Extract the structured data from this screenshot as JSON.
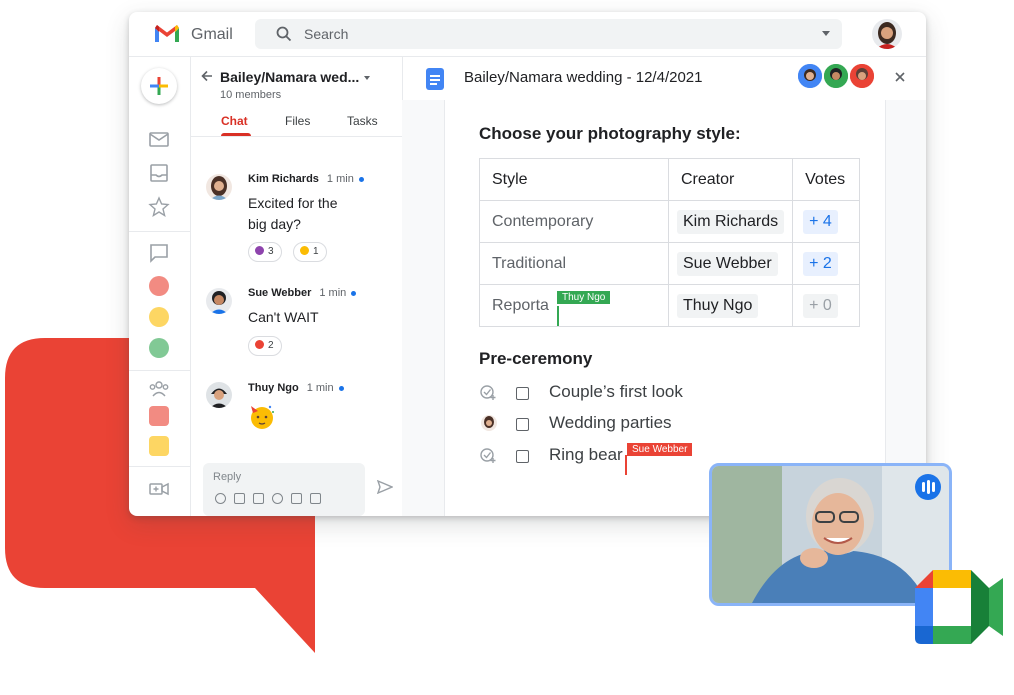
{
  "app": {
    "name": "Gmail",
    "search_placeholder": "Search"
  },
  "chat": {
    "room_title": "Bailey/Namara wed...",
    "members": "10 members",
    "tabs": [
      "Chat",
      "Files",
      "Tasks"
    ],
    "active_tab": "Chat",
    "messages": [
      {
        "author": "Kim Richards",
        "time": "1 min",
        "lines": [
          "Excited for the",
          "big day?"
        ],
        "reactions": [
          {
            "emoji": "wave-hand",
            "count": "3"
          },
          {
            "emoji": "clap-hand",
            "count": "1"
          }
        ]
      },
      {
        "author": "Sue Webber",
        "time": "1 min",
        "lines": [
          "Can't WAIT"
        ],
        "reactions": [
          {
            "emoji": "heart",
            "count": "2"
          }
        ]
      },
      {
        "author": "Thuy Ngo",
        "time": "1 min",
        "emoji": "partying-face"
      }
    ],
    "reply_placeholder": "Reply"
  },
  "doc": {
    "title": "Bailey/Namara wedding - 12/4/2021",
    "heading": "Choose your photography style:",
    "table": {
      "headers": [
        "Style",
        "Creator",
        "Votes"
      ],
      "rows": [
        {
          "style": "Contemporary",
          "creator": "Kim Richards",
          "votes": "+ 4"
        },
        {
          "style": "Traditional",
          "creator": "Sue Webber",
          "votes": "+ 2"
        },
        {
          "style": "Reporta",
          "creator": "Thuy Ngo",
          "votes": "+ 0"
        }
      ]
    },
    "cursors": [
      "Thuy Ngo",
      "Sue Webber"
    ],
    "section2": "Pre-ceremony",
    "tasks": [
      "Couple’s first look",
      "Wedding parties",
      "Ring bear"
    ]
  },
  "colors": {
    "bubble_red": "#ea4335",
    "accent_blue": "#1a73e8",
    "chat_tab_red": "#d93025",
    "cursor_green": "#34a853",
    "cursor_red": "#ea4335",
    "rail_dots": [
      "#f28b82",
      "#fdd663",
      "#81c995"
    ],
    "rail_squares": [
      "#f28b82",
      "#fdd663"
    ]
  }
}
